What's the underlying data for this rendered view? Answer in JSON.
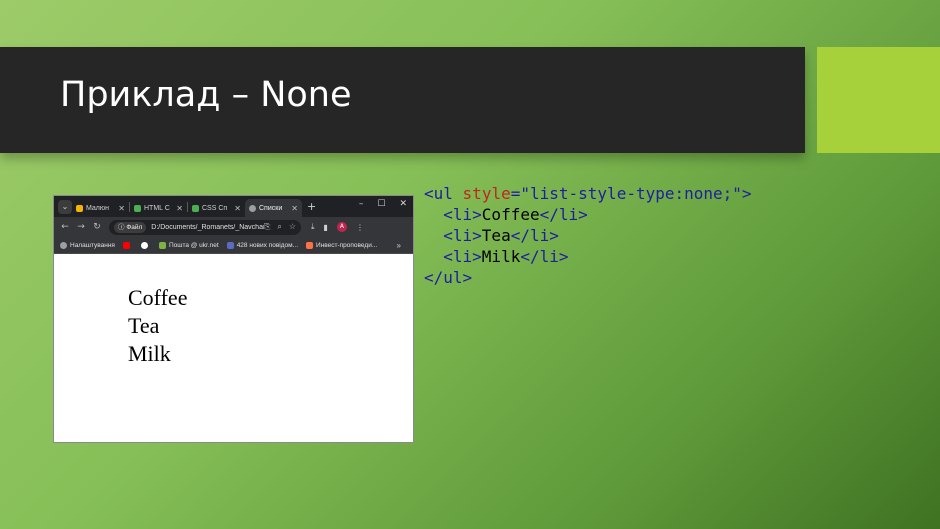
{
  "slide": {
    "title": "Приклад – None",
    "accent_color": "#a6d13a",
    "title_bar_color": "#262626"
  },
  "browser": {
    "tabs": [
      {
        "label": "Малюн",
        "favicon_color": "#f4b400",
        "active": false
      },
      {
        "label": "HTML С",
        "favicon_color": "#4caf50",
        "active": false
      },
      {
        "label": "CSS Сп",
        "favicon_color": "#4caf50",
        "active": false
      },
      {
        "label": "Списки",
        "favicon_color": "#9e9e9e",
        "active": true
      }
    ],
    "new_tab": "+",
    "window_controls": {
      "minimize": "–",
      "maximize": "☐",
      "close": "✕"
    },
    "omnibox": {
      "badge": "Файл",
      "url": "D:/Documents/_Romanets/_Navchann..."
    },
    "avatar_letter": "A",
    "bookmarks": [
      {
        "label": "Налаштування",
        "icon_color": "#9aa0a6"
      },
      {
        "label": "",
        "icon_color": "#ff0000"
      },
      {
        "label": "",
        "icon_color": "#ffffff"
      },
      {
        "label": "Пошта @ ukr.net",
        "icon_color": "#7cb342"
      },
      {
        "label": "428 нових повідом...",
        "icon_color": "#5c6bc0"
      },
      {
        "label": "Инвест-проповеди...",
        "icon_color": "#ff7043"
      }
    ],
    "bookmarks_more": "»",
    "page_items": [
      "Coffee",
      "Tea",
      "Milk"
    ]
  },
  "code": {
    "open_tag": "<ul",
    "attr": "style",
    "eq": "=",
    "value": "\"list-style-type:none;\"",
    "gt": ">",
    "li_open": "<li>",
    "li_close": "</li>",
    "items": [
      "Coffee",
      "Tea",
      "Milk"
    ],
    "close_tag": "</ul>"
  }
}
